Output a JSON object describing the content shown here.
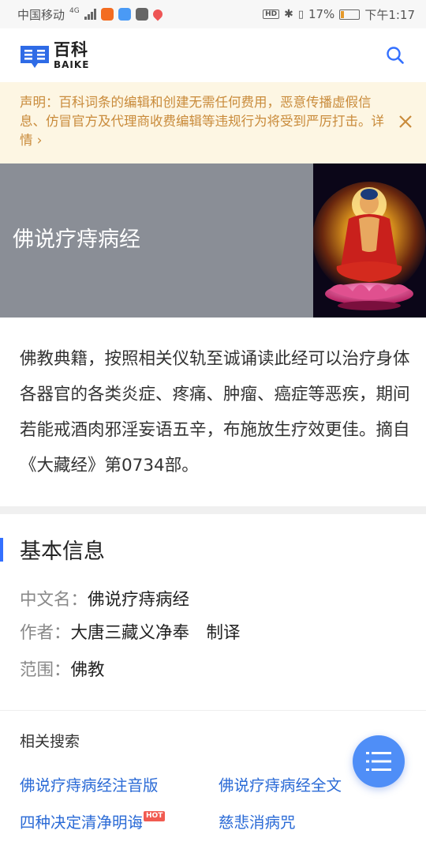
{
  "status_bar": {
    "carrier": "中国移动",
    "network": "4G",
    "hd": "HD",
    "battery": "17%",
    "battery_level": 0.17,
    "time": "下午1:17"
  },
  "header": {
    "logo_cn": "百科",
    "logo_en": "BAIKE",
    "search_icon": "search-icon"
  },
  "notice": {
    "text": "声明：百科词条的编辑和创建无需任何费用，恶意传播虚假信息、仿冒官方及代理商收费编辑等违规行为将受到严厉打击。",
    "link": "详情",
    "link_icon": "chevron-right-icon",
    "close_icon": "close-icon"
  },
  "banner": {
    "title": "佛说疗痔病经"
  },
  "summary": "佛教典籍，按照相关仪轨至诚诵读此经可以治疗身体各器官的各类炎症、疼痛、肿瘤、癌症等恶疾，期间若能戒酒肉邪淫妄语五辛，布施放生疗效更佳。摘自《大藏经》第0734部。",
  "basic_info": {
    "title": "基本信息",
    "rows": [
      {
        "key": "中文名：",
        "value": "佛说疗痔病经"
      },
      {
        "key": "作者：",
        "value": "大唐三藏义净奉　制译"
      },
      {
        "key": "范围：",
        "value": "佛教"
      }
    ]
  },
  "related": {
    "title": "相关搜索",
    "items": [
      {
        "label": "佛说疗痔病经注音版"
      },
      {
        "label": "佛说疗痔病经全文"
      },
      {
        "label": "四种决定清净明诲",
        "badge": "HOT"
      },
      {
        "label": "慈悲消病咒"
      }
    ]
  },
  "fab": {
    "icon": "menu-icon"
  },
  "colors": {
    "accent": "#3370ff",
    "notice_bg": "#fdf6e3",
    "notice_text": "#c98b3b",
    "banner_bg": "#8a8e96",
    "link": "#2a6ad6",
    "fab": "#4f8ef7"
  }
}
